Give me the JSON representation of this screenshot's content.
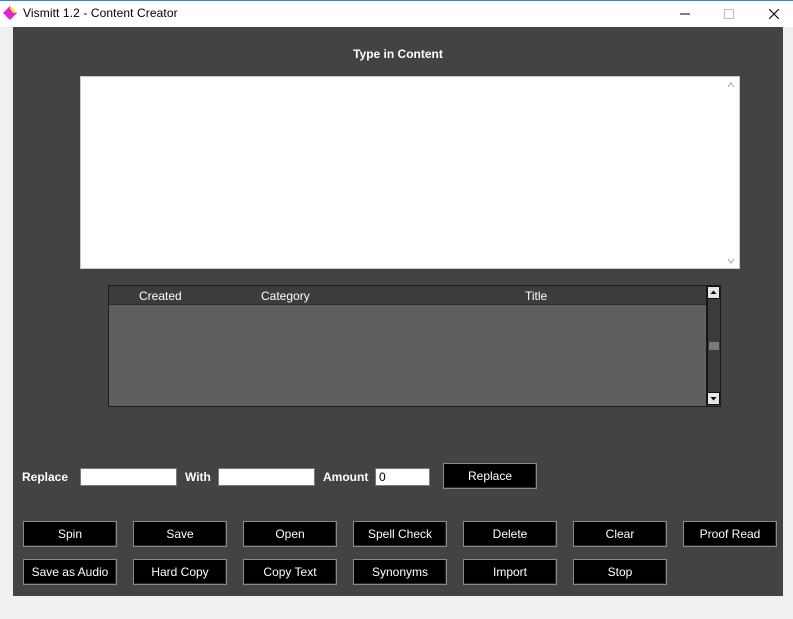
{
  "window": {
    "title": "Vismitt 1.2 - Content Creator",
    "icon": "diamond-app-icon",
    "controls": {
      "minimize": "minimize-icon",
      "maximize": "maximize-icon",
      "close": "close-icon"
    }
  },
  "content": {
    "heading": "Type in Content",
    "value": ""
  },
  "table": {
    "columns": [
      "Created",
      "Category",
      "Title"
    ],
    "rows": []
  },
  "replace_bar": {
    "replace_label": "Replace",
    "replace_value": "",
    "with_label": "With",
    "with_value": "",
    "amount_label": "Amount",
    "amount_value": "0",
    "button_label": "Replace"
  },
  "buttons": {
    "spin": "Spin",
    "save": "Save",
    "open": "Open",
    "spell_check": "Spell Check",
    "delete": "Delete",
    "clear": "Clear",
    "proof_read": "Proof Read",
    "save_audio": "Save as Audio",
    "hard_copy": "Hard Copy",
    "copy_text": "Copy Text",
    "synonyms": "Synonyms",
    "import": "Import",
    "stop": "Stop"
  },
  "colors": {
    "background": "#434343",
    "list_background": "#5f5f5f",
    "button_background": "#000000",
    "app_icon_magenta": "#e61fd9",
    "app_icon_yellow": "#f5e600"
  }
}
